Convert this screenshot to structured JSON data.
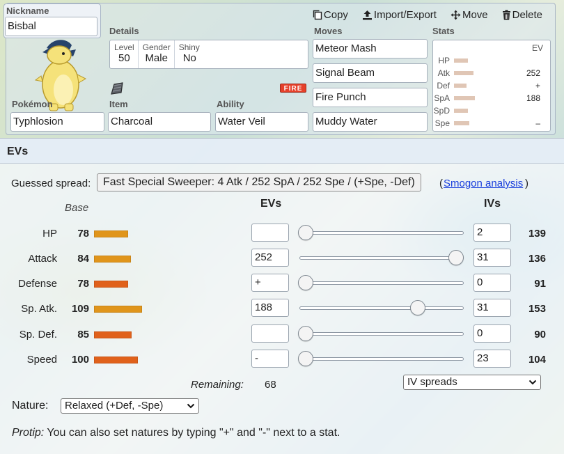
{
  "set": {
    "nickname_label": "Nickname",
    "nickname": "Bisbal",
    "actions": [
      {
        "label": "Copy",
        "icon": "clipboard-icon"
      },
      {
        "label": "Import/Export",
        "icon": "upload-icon"
      },
      {
        "label": "Move",
        "icon": "move-arrows-icon"
      },
      {
        "label": "Delete",
        "icon": "trash-icon"
      }
    ],
    "details_label": "Details",
    "details": {
      "level_label": "Level",
      "level": "50",
      "gender_label": "Gender",
      "gender": "Male",
      "shiny_label": "Shiny",
      "shiny": "No"
    },
    "pokemon_label": "Pokémon",
    "pokemon": "Typhlosion",
    "item_label": "Item",
    "item": "Charcoal",
    "ability_label": "Ability",
    "ability": "Water Veil",
    "type_badge": "FIRE",
    "moves_label": "Moves",
    "moves": [
      "Meteor Mash",
      "Signal Beam",
      "Fire Punch",
      "Muddy Water"
    ],
    "stats_label": "Stats",
    "stats_ev_header": "EV",
    "stats": [
      {
        "label": "HP",
        "ev": "",
        "bar": 0.25
      },
      {
        "label": "Atk",
        "ev": "252",
        "bar": 0.35
      },
      {
        "label": "Def",
        "ev": "+",
        "bar": 0.22
      },
      {
        "label": "SpA",
        "ev": "188",
        "bar": 0.38
      },
      {
        "label": "SpD",
        "ev": "",
        "bar": 0.25
      },
      {
        "label": "Spe",
        "ev": "–",
        "bar": 0.28
      }
    ]
  },
  "evs": {
    "title": "EVs",
    "guessed_label": "Guessed spread:",
    "guessed_spread": "Fast Special Sweeper: 4 Atk / 252 SpA / 252 Spe / (+Spe, -Def)",
    "smogon_link": "Smogon analysis",
    "paren_open": "(",
    "paren_close": ")",
    "base_header": "Base",
    "ev_header": "EVs",
    "iv_header": "IVs",
    "rows": [
      {
        "name": "HP",
        "base": "78",
        "base_color": "#e0951b",
        "ev": "",
        "ev_fraction": 0,
        "iv": "2",
        "total": "139"
      },
      {
        "name": "Attack",
        "base": "84",
        "base_color": "#e0951b",
        "ev": "252",
        "ev_fraction": 1.0,
        "iv": "31",
        "total": "136"
      },
      {
        "name": "Defense",
        "base": "78",
        "base_color": "#e0611b",
        "ev": "+",
        "ev_fraction": 0,
        "iv": "0",
        "total": "91"
      },
      {
        "name": "Sp. Atk.",
        "base": "109",
        "base_color": "#e0951b",
        "ev": "188",
        "ev_fraction": 0.746,
        "iv": "31",
        "total": "153"
      },
      {
        "name": "Sp. Def.",
        "base": "85",
        "base_color": "#e0611b",
        "ev": "",
        "ev_fraction": 0,
        "iv": "0",
        "total": "90"
      },
      {
        "name": "Speed",
        "base": "100",
        "base_color": "#e0611b",
        "ev": "-",
        "ev_fraction": 0,
        "iv": "23",
        "total": "104"
      }
    ],
    "remaining_label": "Remaining:",
    "remaining": "68",
    "iv_spreads_select": "IV spreads",
    "nature_label": "Nature:",
    "nature": "Relaxed (+Def, -Spe)",
    "protip_label": "Protip:",
    "protip": " You can also set natures by typing \"+\" and \"-\" next to a stat."
  }
}
